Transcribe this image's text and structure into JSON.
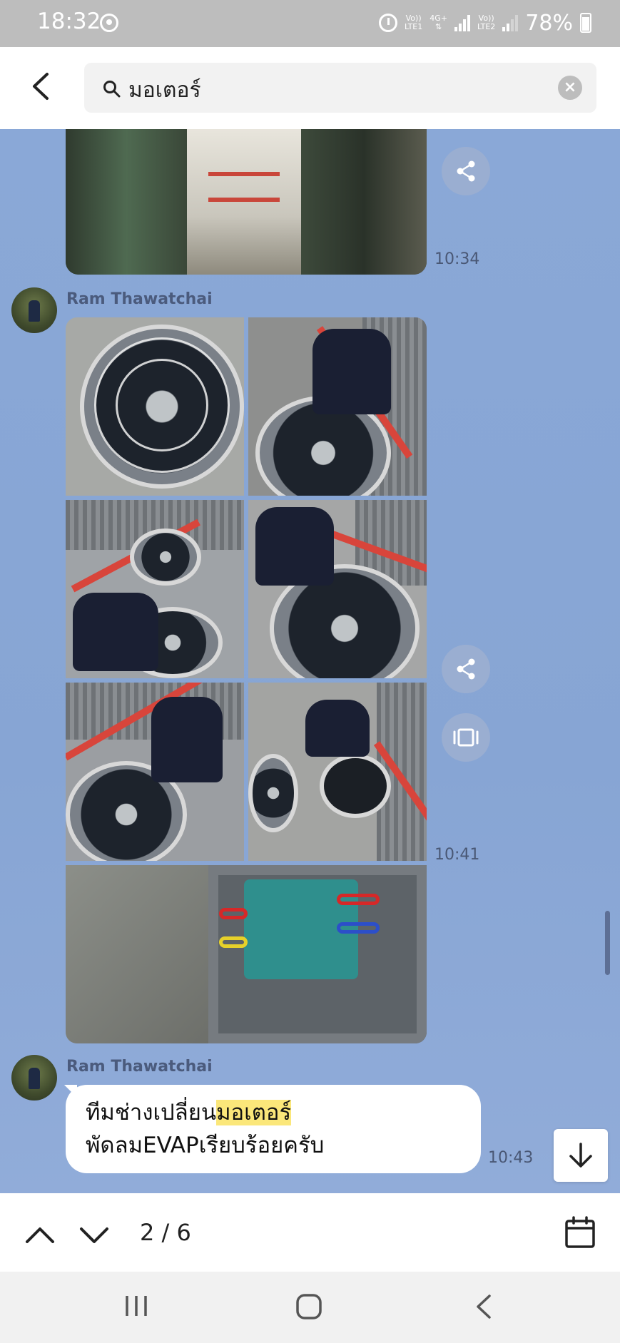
{
  "status_bar": {
    "time": "18:32",
    "network_1_top": "Vo))",
    "network_1_bottom": "LTE1",
    "network_type": "4G+",
    "network_2_top": "Vo))",
    "network_2_bottom": "LTE2",
    "battery": "78%"
  },
  "search": {
    "query": "มอเตอร์"
  },
  "messages": [
    {
      "type": "photo",
      "time": "10:34"
    },
    {
      "type": "photo_group",
      "sender": "Ram Thawatchai",
      "time": "10:41",
      "photo_count": 7
    },
    {
      "type": "text",
      "sender": "Ram Thawatchai",
      "line1_before": "ทีมช่างเปลี่ยน",
      "line1_highlight": "มอเตอร์",
      "line2": "พัดลมEVAPเรียบร้อยครับ",
      "time": "10:43"
    }
  ],
  "footer": {
    "match_count": "2 / 6"
  },
  "colors": {
    "chat_background": "#8aa6d6",
    "highlight": "#fbe77a",
    "sender_name": "#4b5b7d"
  },
  "icons": [
    "back-arrow-icon",
    "search-icon",
    "clear-icon",
    "share-icon",
    "collage-icon",
    "arrow-down-icon",
    "chevron-up-icon",
    "chevron-down-icon",
    "calendar-icon"
  ]
}
